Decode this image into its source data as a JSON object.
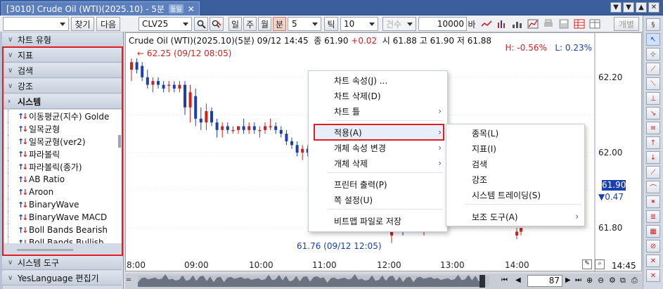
{
  "window": {
    "tab_title": "[3010] Crude Oil (WTI)(2025.10) - 5분",
    "tab_tag": "동일",
    "close": "✕",
    "controls": [
      "▼",
      "▼",
      "▲",
      "✕"
    ]
  },
  "toolbar": {
    "find_label": "찾기",
    "next_label": "다음",
    "symbol": "CLV25",
    "period_buttons": [
      "일",
      "주",
      "월",
      "분"
    ],
    "active_period": "분",
    "interval": "5",
    "tick_label": "틱",
    "tick_value": "10",
    "qty_label": "건수",
    "qty_value": "10000",
    "bar_label": "바",
    "individual_label": "개별"
  },
  "sidebar": {
    "groups": [
      {
        "label": "차트 유형",
        "icon": "chevron-down-icon"
      },
      {
        "label": "지표",
        "icon": "chevron-down-icon"
      },
      {
        "label": "검색",
        "icon": "chevron-down-icon"
      },
      {
        "label": "강조",
        "icon": "chevron-down-icon"
      },
      {
        "label": "시스템",
        "icon": "chevron-right-icon"
      }
    ],
    "system_items": [
      "이동평균(지수) Golde",
      "일목균형",
      "일목균형(ver2)",
      "파라볼릭",
      "파라볼릭(종가)",
      "AB Ratio",
      "Aroon",
      "BinaryWave",
      "BinaryWave MACD",
      "Boll Bands Bearish",
      "Boll Bands Bullish"
    ],
    "footer_groups": [
      {
        "label": "시스템 도구",
        "icon": "chevron-down-icon"
      },
      {
        "label": "YesLanguage 편집기",
        "icon": "chevron-down-icon"
      }
    ]
  },
  "chart": {
    "header": {
      "name": "Crude Oil (WTI)(2025.10)(5분) 09/12 14:45",
      "close_label": "종",
      "close": "61.90",
      "change": "+0.02",
      "open_label": "시",
      "open": "61.88",
      "high_label": "고",
      "high": "61.90",
      "low_label": "저",
      "low": "61.88"
    },
    "hl_high": "H: -0.56%",
    "hl_low": "L: 0.23%",
    "annotation_high": "62.25 (09/12 08:05)",
    "annotation_low": "61.76 (09/12 12:05)",
    "current_price": "61.90",
    "current_change": "▼0.47",
    "time_label": "14:45"
  },
  "chart_data": {
    "type": "candlestick",
    "y_ticks": [
      "62.20",
      "62.00",
      "61.80"
    ],
    "ylim": [
      61.72,
      62.28
    ],
    "x_ticks": [
      "8:00",
      "09:00",
      "10:00",
      "11:00",
      "12:00",
      "13:00",
      "14:00"
    ],
    "candles": [
      {
        "o": 62.22,
        "h": 62.25,
        "l": 62.19,
        "c": 62.24
      },
      {
        "o": 62.24,
        "h": 62.25,
        "l": 62.21,
        "c": 62.22
      },
      {
        "o": 62.23,
        "h": 62.24,
        "l": 62.19,
        "c": 62.2
      },
      {
        "o": 62.2,
        "h": 62.22,
        "l": 62.17,
        "c": 62.18
      },
      {
        "o": 62.18,
        "h": 62.2,
        "l": 62.16,
        "c": 62.19
      },
      {
        "o": 62.19,
        "h": 62.2,
        "l": 62.17,
        "c": 62.18
      },
      {
        "o": 62.18,
        "h": 62.19,
        "l": 62.16,
        "c": 62.17
      },
      {
        "o": 62.18,
        "h": 62.19,
        "l": 62.16,
        "c": 62.18
      },
      {
        "o": 62.18,
        "h": 62.19,
        "l": 62.16,
        "c": 62.17
      },
      {
        "o": 62.17,
        "h": 62.19,
        "l": 62.16,
        "c": 62.18
      },
      {
        "o": 62.18,
        "h": 62.19,
        "l": 62.1,
        "c": 62.12
      },
      {
        "o": 62.12,
        "h": 62.18,
        "l": 62.08,
        "c": 62.16
      },
      {
        "o": 62.15,
        "h": 62.17,
        "l": 62.07,
        "c": 62.09
      },
      {
        "o": 62.09,
        "h": 62.12,
        "l": 62.06,
        "c": 62.08
      },
      {
        "o": 62.08,
        "h": 62.13,
        "l": 62.06,
        "c": 62.11
      },
      {
        "o": 62.11,
        "h": 62.12,
        "l": 62.07,
        "c": 62.08
      },
      {
        "o": 62.08,
        "h": 62.09,
        "l": 62.04,
        "c": 62.06
      },
      {
        "o": 62.06,
        "h": 62.08,
        "l": 62.04,
        "c": 62.07
      },
      {
        "o": 62.07,
        "h": 62.08,
        "l": 62.05,
        "c": 62.06
      },
      {
        "o": 62.06,
        "h": 62.07,
        "l": 62.05,
        "c": 62.06
      },
      {
        "o": 62.06,
        "h": 62.07,
        "l": 62.05,
        "c": 62.07
      },
      {
        "o": 62.07,
        "h": 62.09,
        "l": 62.05,
        "c": 62.06
      },
      {
        "o": 62.06,
        "h": 62.08,
        "l": 62.05,
        "c": 62.07
      },
      {
        "o": 62.07,
        "h": 62.08,
        "l": 62.05,
        "c": 62.06
      },
      {
        "o": 62.06,
        "h": 62.07,
        "l": 62.04,
        "c": 62.06
      },
      {
        "o": 62.06,
        "h": 62.08,
        "l": 62.05,
        "c": 62.07
      },
      {
        "o": 62.07,
        "h": 62.09,
        "l": 62.06,
        "c": 62.07
      },
      {
        "o": 62.07,
        "h": 62.08,
        "l": 62.05,
        "c": 62.06
      },
      {
        "o": 62.06,
        "h": 62.07,
        "l": 62.04,
        "c": 62.05
      },
      {
        "o": 62.05,
        "h": 62.06,
        "l": 62.02,
        "c": 62.03
      },
      {
        "o": 62.03,
        "h": 62.04,
        "l": 62.01,
        "c": 62.02
      },
      {
        "o": 62.02,
        "h": 62.03,
        "l": 61.99,
        "c": 62.0
      },
      {
        "o": 62.0,
        "h": 62.02,
        "l": 61.98,
        "c": 62.01
      },
      {
        "o": 62.01,
        "h": 62.02,
        "l": 61.99,
        "c": 62.0
      }
    ],
    "tail_candles": [
      {
        "o": 61.78,
        "h": 61.81,
        "l": 61.76,
        "c": 61.8
      },
      {
        "o": 61.8,
        "h": 61.81,
        "l": 61.78,
        "c": 61.79
      },
      {
        "o": 61.79,
        "h": 61.81,
        "l": 61.78,
        "c": 61.8
      },
      {
        "o": 61.78,
        "h": 61.8,
        "l": 61.77,
        "c": 61.79
      },
      {
        "o": 61.79,
        "h": 61.8,
        "l": 61.78,
        "c": 61.8
      }
    ]
  },
  "context_menu": {
    "items": [
      {
        "label": "차트 속성(J) ...",
        "submenu": false
      },
      {
        "label": "차트 삭제(D)",
        "submenu": false
      },
      {
        "label": "차트 틀",
        "submenu": true
      },
      {
        "label": "적용(A)",
        "submenu": true,
        "highlight": true
      },
      {
        "label": "개체 속성 변경",
        "submenu": true
      },
      {
        "label": "개체 삭제",
        "submenu": true
      },
      {
        "label": "프린터 출력(P)",
        "submenu": false
      },
      {
        "label": "쪽 설정(U)",
        "submenu": false
      },
      {
        "label": "비트맵 파일로 저장",
        "submenu": false
      }
    ]
  },
  "sub_menu": {
    "items": [
      {
        "label": "종목(L)",
        "submenu": false
      },
      {
        "label": "지표(I)",
        "submenu": false
      },
      {
        "label": "검색",
        "submenu": false
      },
      {
        "label": "강조",
        "submenu": false
      },
      {
        "label": "시스템 트레이딩(S)",
        "submenu": false
      },
      {
        "label": "보조 도구(A)",
        "submenu": true
      }
    ]
  },
  "scroll": {
    "value": "87"
  },
  "colors": {
    "up": "#d02020",
    "down": "#1a3fb0",
    "accent": "#3b5f9c",
    "highlight_border": "#e02020"
  }
}
